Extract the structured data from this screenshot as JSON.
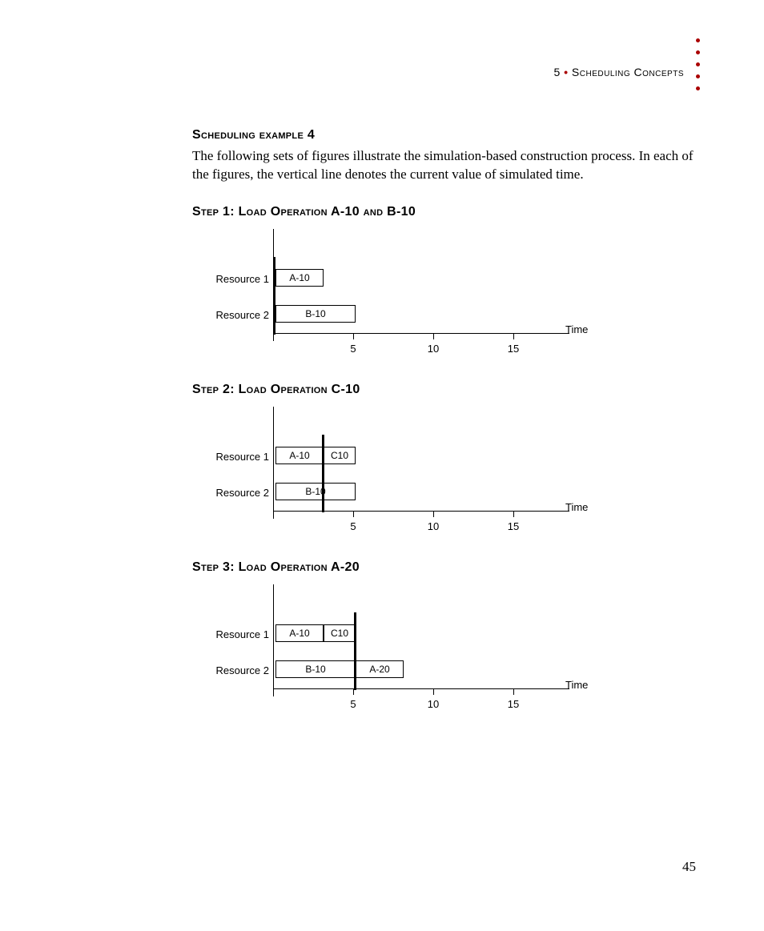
{
  "header": {
    "chapter_number": "5",
    "separator": "•",
    "chapter_title": "Scheduling Concepts"
  },
  "section": {
    "title": "Scheduling example 4",
    "body": "The following sets of figures illustrate the simulation-based construction process. In each of the figures, the vertical line denotes the current value of simulated time."
  },
  "steps": [
    {
      "title": "Step 1: Load Operation A-10 and B-10"
    },
    {
      "title": "Step 2: Load Operation C-10"
    },
    {
      "title": "Step 3: Load Operation A-20"
    }
  ],
  "page_number": "45",
  "chart_data": [
    {
      "type": "bar",
      "title": "Step 1",
      "xlabel": "Time",
      "ylabel_rows": [
        "Resource 1",
        "Resource 2"
      ],
      "x_ticks": [
        5,
        10,
        15
      ],
      "x_range": [
        0,
        18
      ],
      "current_time": 0,
      "bars": [
        {
          "row": "Resource 1",
          "label": "A-10",
          "start": 0,
          "end": 3
        },
        {
          "row": "Resource 2",
          "label": "B-10",
          "start": 0,
          "end": 5
        }
      ]
    },
    {
      "type": "bar",
      "title": "Step 2",
      "xlabel": "Time",
      "ylabel_rows": [
        "Resource 1",
        "Resource 2"
      ],
      "x_ticks": [
        5,
        10,
        15
      ],
      "x_range": [
        0,
        18
      ],
      "current_time": 3,
      "bars": [
        {
          "row": "Resource 1",
          "label": "A-10",
          "start": 0,
          "end": 3
        },
        {
          "row": "Resource 1",
          "label": "C10",
          "start": 3,
          "end": 5
        },
        {
          "row": "Resource 2",
          "label": "B-10",
          "start": 0,
          "end": 5
        }
      ]
    },
    {
      "type": "bar",
      "title": "Step 3",
      "xlabel": "Time",
      "ylabel_rows": [
        "Resource 1",
        "Resource 2"
      ],
      "x_ticks": [
        5,
        10,
        15
      ],
      "x_range": [
        0,
        18
      ],
      "current_time": 5,
      "bars": [
        {
          "row": "Resource 1",
          "label": "A-10",
          "start": 0,
          "end": 3
        },
        {
          "row": "Resource 1",
          "label": "C10",
          "start": 3,
          "end": 5
        },
        {
          "row": "Resource 2",
          "label": "B-10",
          "start": 0,
          "end": 5
        },
        {
          "row": "Resource 2",
          "label": "A-20",
          "start": 5,
          "end": 8
        }
      ]
    }
  ]
}
